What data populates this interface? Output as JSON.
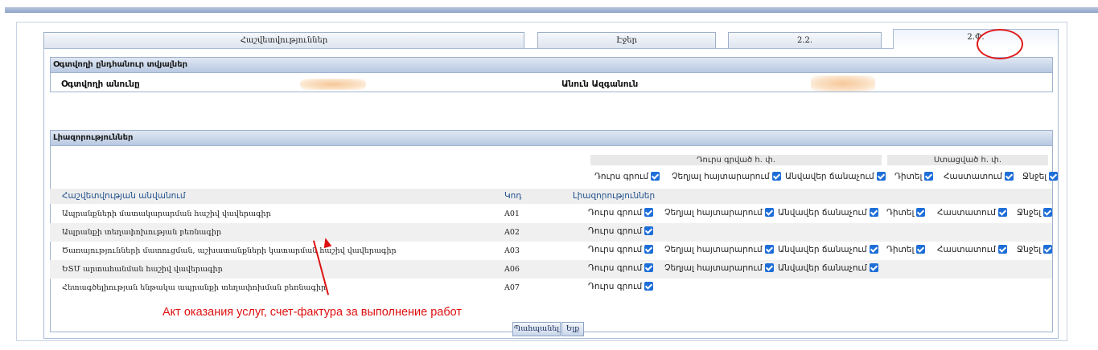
{
  "tabs": [
    {
      "label": "Հաշվետվություններ",
      "active": false
    },
    {
      "label": "Էջեր",
      "active": false
    },
    {
      "label": "2.2.",
      "active": false
    },
    {
      "label": "2.Փ.",
      "active": true
    }
  ],
  "user_section": {
    "title": "Օգտվողի ընդհանուր տվյալներ",
    "username_label": "Օգտվողի անունը",
    "fullname_label": "Անուն Ազգանուն"
  },
  "permissions_section": {
    "title": "Լիազորություններ",
    "group_outgoing": "Դուրս գրված հ. փ.",
    "group_received": "Ստացված հ. փ.",
    "header_perms": [
      "Դուրս գրում",
      "Չեղյալ հայտարարում",
      "Անվավեր ճանաչում",
      "Դիտել",
      "Հաստատում",
      "Ջնջել"
    ],
    "columns": {
      "name": "Հաշվետվության անվանում",
      "code": "Կոդ",
      "perms": "Լիազորություններ"
    },
    "rows": [
      {
        "name": "Ապրանքների մատակարարման հաշիվ վավերագիր",
        "code": "A01",
        "perms": [
          "Դուրս գրում",
          "Չեղյալ հայտարարում",
          "Անվավեր ճանաչում",
          "Դիտել",
          "Հաստատում",
          "Ջնջել"
        ]
      },
      {
        "name": "Ապրանքի տեղափոխության բեռնագիր",
        "code": "A02",
        "perms": [
          "Դուրս գրում"
        ]
      },
      {
        "name": "Ծառայությունների մատուցման, աշխատանքների կատարման հաշիվ վավերագիր",
        "code": "A03",
        "perms": [
          "Դուրս գրում",
          "Չեղյալ հայտարարում",
          "Անվավեր ճանաչում",
          "Դիտել",
          "Հաստատում",
          "Ջնջել"
        ]
      },
      {
        "name": "ԵՏՄ արտահանման հաշիվ վավերագիր",
        "code": "A06",
        "perms": [
          "Դուրս գրում",
          "Չեղյալ հայտարարում",
          "Անվավեր ճանաչում"
        ]
      },
      {
        "name": "Հետագծելիության ենթակա ապրանքի տեղափոխման բեռնագիր",
        "code": "A07",
        "perms": [
          "Դուրս գրում"
        ]
      }
    ]
  },
  "buttons": {
    "save": "Պահպանել",
    "exit": "Ելք"
  },
  "annotation": "Акт оказания услуг, счет-фактура за выполнение работ",
  "colors": {
    "checkbox": "#1e6ed8",
    "annotation": "#dd1111",
    "header_gradient_end": "#b8c9e2"
  }
}
